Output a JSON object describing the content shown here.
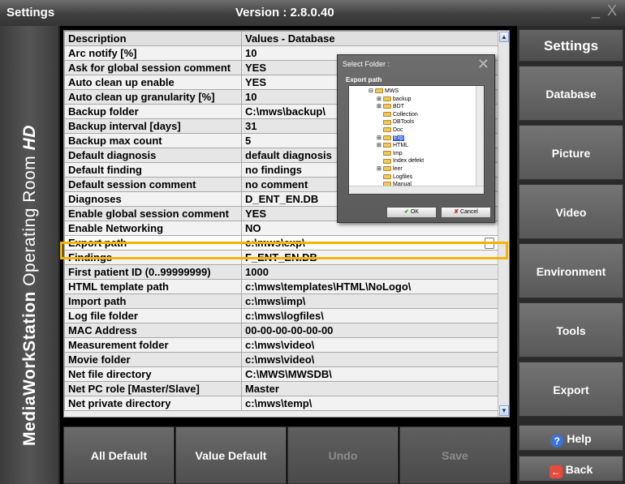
{
  "window": {
    "title": "Settings",
    "version": "Version : 2.8.0.40",
    "controls": "_ X"
  },
  "banner": {
    "brand": "MediaWorkStation",
    "product": "Operating Room",
    "badge": "HD"
  },
  "table": {
    "headers": [
      "Description",
      "Values - Database"
    ],
    "rows": [
      {
        "desc": "Arc notify [%]",
        "value": "10"
      },
      {
        "desc": "Ask for global session comment",
        "value": "YES"
      },
      {
        "desc": "Auto clean up enable",
        "value": "YES"
      },
      {
        "desc": "Auto clean up granularity [%]",
        "value": "10"
      },
      {
        "desc": "Backup folder",
        "value": "C:\\mws\\backup\\"
      },
      {
        "desc": "Backup interval [days]",
        "value": "31"
      },
      {
        "desc": "Backup max count",
        "value": "5"
      },
      {
        "desc": "Default diagnosis",
        "value": "default diagnosis"
      },
      {
        "desc": "Default finding",
        "value": "no findings"
      },
      {
        "desc": "Default session comment",
        "value": "no comment"
      },
      {
        "desc": "Diagnoses",
        "value": "D_ENT_EN.DB"
      },
      {
        "desc": "Enable global session comment",
        "value": "YES"
      },
      {
        "desc": "Enable Networking",
        "value": "NO"
      },
      {
        "desc": "Export path",
        "value": "c:\\mws\\exp\\"
      },
      {
        "desc": "Findings",
        "value": "F_ENT_EN.DB"
      },
      {
        "desc": "First patient ID (0..99999999)",
        "value": "1000"
      },
      {
        "desc": "HTML template path",
        "value": "c:\\mws\\templates\\HTML\\NoLogo\\"
      },
      {
        "desc": "Import path",
        "value": "c:\\mws\\imp\\"
      },
      {
        "desc": "Log file folder",
        "value": "c:\\mws\\logfiles\\"
      },
      {
        "desc": "MAC Address",
        "value": "00-00-00-00-00-00"
      },
      {
        "desc": "Measurement folder",
        "value": "c:\\mws\\video\\"
      },
      {
        "desc": "Movie folder",
        "value": "c:\\mws\\video\\"
      },
      {
        "desc": "Net file directory",
        "value": "C:\\MWS\\MWSDB\\"
      },
      {
        "desc": "Net PC role [Master/Slave]",
        "value": "Master"
      },
      {
        "desc": "Net private directory",
        "value": "c:\\mws\\temp\\"
      }
    ],
    "selected_index": 13
  },
  "dialog": {
    "title": "Select Folder :",
    "section": "Export path",
    "tree": [
      {
        "label": "MWS",
        "level": 0,
        "expander": "⊟"
      },
      {
        "label": "backup",
        "level": 1,
        "expander": "⊞"
      },
      {
        "label": "BDT",
        "level": 1,
        "expander": "⊞"
      },
      {
        "label": "Collection",
        "level": 1,
        "expander": ""
      },
      {
        "label": "DBTools",
        "level": 1,
        "expander": ""
      },
      {
        "label": "Doc",
        "level": 1,
        "expander": ""
      },
      {
        "label": "Exp",
        "level": 1,
        "expander": "⊞",
        "selected": true
      },
      {
        "label": "HTML",
        "level": 1,
        "expander": "⊞"
      },
      {
        "label": "Imp",
        "level": 1,
        "expander": ""
      },
      {
        "label": "Index defekt",
        "level": 1,
        "expander": ""
      },
      {
        "label": "leer",
        "level": 1,
        "expander": "⊞"
      },
      {
        "label": "Logfiles",
        "level": 1,
        "expander": ""
      },
      {
        "label": "Manual",
        "level": 1,
        "expander": ""
      }
    ],
    "ok_label": "OK",
    "cancel_label": "Cancel"
  },
  "bottom_buttons": {
    "all_default": "All Default",
    "value_default": "Value Default",
    "undo": "Undo",
    "save": "Save"
  },
  "right_panel": {
    "header": "Settings",
    "buttons": [
      "Database",
      "Picture",
      "Video",
      "Environment",
      "Tools",
      "Export"
    ],
    "help": "Help",
    "back": "Back"
  },
  "colors": {
    "highlight": "#f4b400",
    "help_icon": "#3b73d8",
    "back_icon": "#e84b3c"
  }
}
